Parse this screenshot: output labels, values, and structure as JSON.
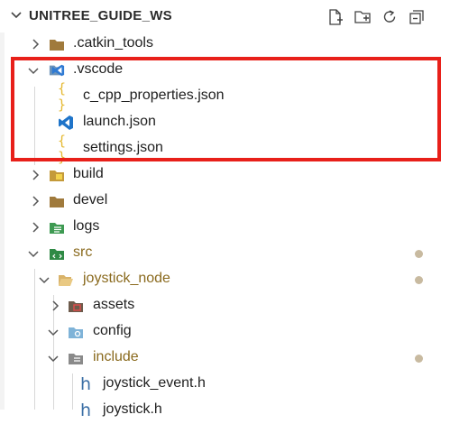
{
  "explorer": {
    "title": "UNITREE_GUIDE_WS",
    "actions": [
      {
        "name": "new-file-icon"
      },
      {
        "name": "new-folder-icon"
      },
      {
        "name": "refresh-icon"
      },
      {
        "name": "collapse-all-icon"
      }
    ]
  },
  "tree": [
    {
      "label": ".catkin_tools",
      "depth": 0,
      "type": "folder",
      "expanded": false,
      "icon": "folder-icon"
    },
    {
      "label": ".vscode",
      "depth": 0,
      "type": "folder",
      "expanded": true,
      "icon": "vscode-folder-icon",
      "selected": true
    },
    {
      "label": "c_cpp_properties.json",
      "depth": 1,
      "type": "file",
      "icon": "json-icon"
    },
    {
      "label": "launch.json",
      "depth": 1,
      "type": "file",
      "icon": "vscode-icon"
    },
    {
      "label": "settings.json",
      "depth": 1,
      "type": "file",
      "icon": "json-icon"
    },
    {
      "label": "build",
      "depth": 0,
      "type": "folder",
      "expanded": false,
      "icon": "build-folder-icon"
    },
    {
      "label": "devel",
      "depth": 0,
      "type": "folder",
      "expanded": false,
      "icon": "folder-icon"
    },
    {
      "label": "logs",
      "depth": 0,
      "type": "folder",
      "expanded": false,
      "icon": "logs-folder-icon"
    },
    {
      "label": "src",
      "depth": 0,
      "type": "folder",
      "expanded": true,
      "icon": "src-folder-icon",
      "modified": true
    },
    {
      "label": "joystick_node",
      "depth": 1,
      "type": "folder",
      "expanded": true,
      "icon": "open-folder-icon",
      "modified": true
    },
    {
      "label": "assets",
      "depth": 2,
      "type": "folder",
      "expanded": false,
      "icon": "assets-folder-icon"
    },
    {
      "label": "config",
      "depth": 2,
      "type": "folder",
      "expanded": true,
      "icon": "config-folder-icon"
    },
    {
      "label": "include",
      "depth": 2,
      "type": "folder",
      "expanded": true,
      "icon": "include-folder-icon",
      "modified": true
    },
    {
      "label": "joystick_event.h",
      "depth": 3,
      "type": "file",
      "icon": "header-file-icon"
    },
    {
      "label": "joystick.h",
      "depth": 3,
      "type": "file",
      "icon": "header-file-icon"
    }
  ]
}
